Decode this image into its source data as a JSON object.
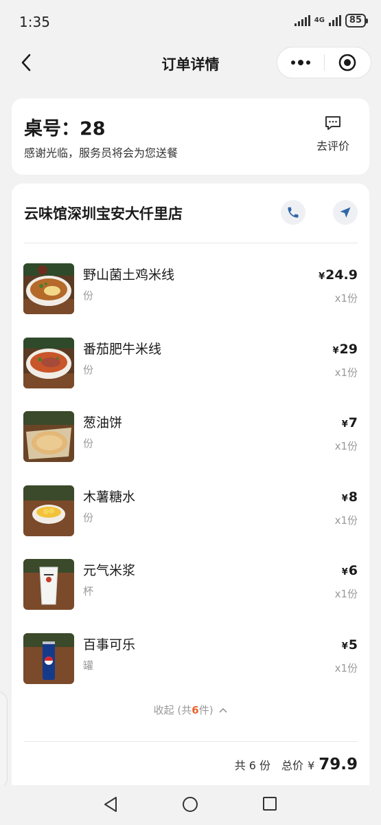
{
  "status_bar": {
    "time": "1:35",
    "network": "4G",
    "battery": "85"
  },
  "nav": {
    "title": "订单详情"
  },
  "table_card": {
    "label": "桌号：",
    "number": "28",
    "subtitle": "感谢光临，服务员将会为您送餐",
    "review_label": "去评价"
  },
  "store": {
    "name": "云味馆深圳宝安大仟里店"
  },
  "items": [
    {
      "name": "野山菌土鸡米线",
      "unit": "份",
      "currency": "¥",
      "price": "24.9",
      "qty": "x1份",
      "thumb": "noodle-chicken"
    },
    {
      "name": "番茄肥牛米线",
      "unit": "份",
      "currency": "¥",
      "price": "29",
      "qty": "x1份",
      "thumb": "noodle-beef"
    },
    {
      "name": "葱油饼",
      "unit": "份",
      "currency": "¥",
      "price": "7",
      "qty": "x1份",
      "thumb": "pancake"
    },
    {
      "name": "木薯糖水",
      "unit": "份",
      "currency": "¥",
      "price": "8",
      "qty": "x1份",
      "thumb": "dessert"
    },
    {
      "name": "元气米浆",
      "unit": "杯",
      "currency": "¥",
      "price": "6",
      "qty": "x1份",
      "thumb": "rice-milk"
    },
    {
      "name": "百事可乐",
      "unit": "罐",
      "currency": "¥",
      "price": "5",
      "qty": "x1份",
      "thumb": "cola"
    }
  ],
  "collapse": {
    "prefix": "收起 (共",
    "count": "6",
    "suffix": "件)"
  },
  "summary": {
    "count_label": "共 6 份",
    "total_label": "总价",
    "currency": "¥",
    "total": "79.9"
  },
  "colors": {
    "accent": "#e8632b",
    "icon_blue": "#2f66a8",
    "background": "#f2f2f2"
  }
}
